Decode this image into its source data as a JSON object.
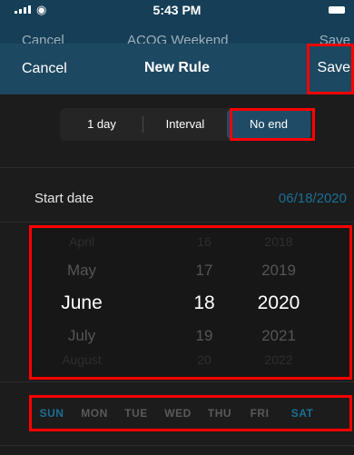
{
  "status": {
    "time": "5:43 PM"
  },
  "underlay": {
    "left": "Cancel",
    "center": "ACOG Weekend",
    "right": "Save"
  },
  "nav": {
    "cancel": "Cancel",
    "title": "New Rule",
    "save": "Save"
  },
  "segments": [
    "1 day",
    "Interval",
    "No end"
  ],
  "selected_segment": "No end",
  "start_date": {
    "label": "Start date",
    "value": "06/18/2020"
  },
  "picker": {
    "months": [
      "April",
      "May",
      "June",
      "July",
      "August"
    ],
    "days": [
      "16",
      "17",
      "18",
      "19",
      "20"
    ],
    "years": [
      "2018",
      "2019",
      "2020",
      "2021",
      "2022"
    ],
    "selected": {
      "month": "June",
      "day": "18",
      "year": "2020"
    }
  },
  "weekdays": [
    "SUN",
    "MON",
    "TUE",
    "WED",
    "THU",
    "FRI",
    "SAT"
  ],
  "selected_weekdays": [
    "SUN",
    "SAT"
  ],
  "colors": {
    "accent": "#1b6f95",
    "nav": "#1d4861",
    "highlight": "#ff0000"
  }
}
